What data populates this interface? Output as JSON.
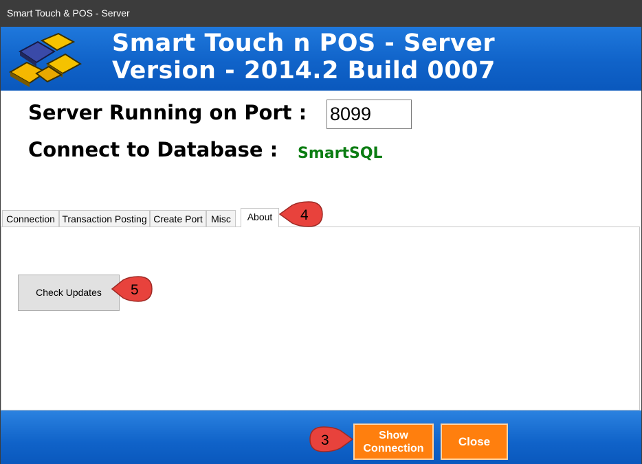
{
  "window": {
    "title": "Smart Touch & POS - Server"
  },
  "header": {
    "line1": "Smart Touch n POS - Server",
    "line2": "Version - 2014.2 Build 0007"
  },
  "server": {
    "port_label": "Server Running on Port :",
    "port_value": "8099",
    "db_label": "Connect to Database :",
    "db_value": "SmartSQL"
  },
  "tabs": [
    {
      "label": "Connection"
    },
    {
      "label": "Transaction Posting"
    },
    {
      "label": "Create Port"
    },
    {
      "label": "Misc"
    },
    {
      "label": "About",
      "active": true
    }
  ],
  "about": {
    "check_updates_label": "Check Updates"
  },
  "footer": {
    "show_connection_line1": "Show",
    "show_connection_line2": "Connection",
    "close_label": "Close"
  },
  "callouts": {
    "tab": "4",
    "check_updates": "5",
    "show_connection": "3"
  },
  "colors": {
    "header_blue": "#1063c9",
    "button_orange": "#ff7f0e",
    "db_green": "#0b7d12",
    "callout_red": "#e8423c"
  }
}
